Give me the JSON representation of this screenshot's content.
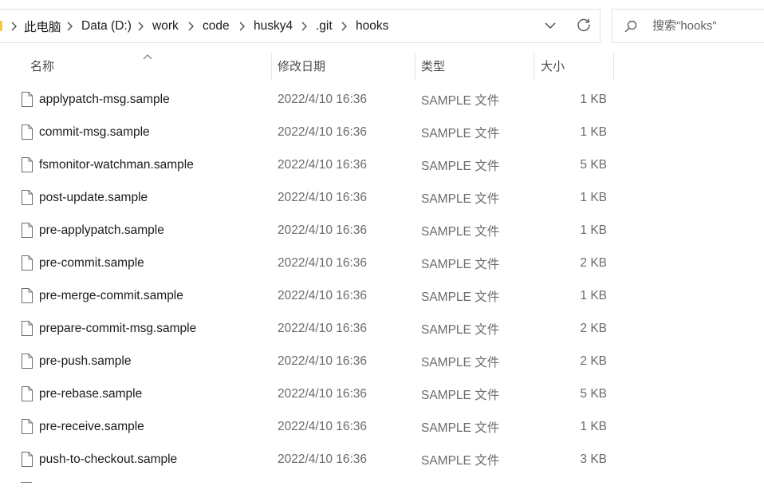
{
  "breadcrumb": {
    "items": [
      "此电脑",
      "Data (D:)",
      "work",
      "code",
      "husky4",
      ".git",
      "hooks"
    ]
  },
  "search": {
    "placeholder": "搜索\"hooks\""
  },
  "icons": {
    "separator": "chevron-right-icon",
    "dropdown": "chevron-down-icon",
    "refresh": "refresh-icon",
    "search": "search-icon",
    "file": "file-icon"
  },
  "columns": {
    "name": "名称",
    "date": "修改日期",
    "type": "类型",
    "size": "大小"
  },
  "files": [
    {
      "name": "applypatch-msg.sample",
      "date": "2022/4/10 16:36",
      "type": "SAMPLE 文件",
      "size": "1 KB"
    },
    {
      "name": "commit-msg.sample",
      "date": "2022/4/10 16:36",
      "type": "SAMPLE 文件",
      "size": "1 KB"
    },
    {
      "name": "fsmonitor-watchman.sample",
      "date": "2022/4/10 16:36",
      "type": "SAMPLE 文件",
      "size": "5 KB"
    },
    {
      "name": "post-update.sample",
      "date": "2022/4/10 16:36",
      "type": "SAMPLE 文件",
      "size": "1 KB"
    },
    {
      "name": "pre-applypatch.sample",
      "date": "2022/4/10 16:36",
      "type": "SAMPLE 文件",
      "size": "1 KB"
    },
    {
      "name": "pre-commit.sample",
      "date": "2022/4/10 16:36",
      "type": "SAMPLE 文件",
      "size": "2 KB"
    },
    {
      "name": "pre-merge-commit.sample",
      "date": "2022/4/10 16:36",
      "type": "SAMPLE 文件",
      "size": "1 KB"
    },
    {
      "name": "prepare-commit-msg.sample",
      "date": "2022/4/10 16:36",
      "type": "SAMPLE 文件",
      "size": "2 KB"
    },
    {
      "name": "pre-push.sample",
      "date": "2022/4/10 16:36",
      "type": "SAMPLE 文件",
      "size": "2 KB"
    },
    {
      "name": "pre-rebase.sample",
      "date": "2022/4/10 16:36",
      "type": "SAMPLE 文件",
      "size": "5 KB"
    },
    {
      "name": "pre-receive.sample",
      "date": "2022/4/10 16:36",
      "type": "SAMPLE 文件",
      "size": "1 KB"
    },
    {
      "name": "push-to-checkout.sample",
      "date": "2022/4/10 16:36",
      "type": "SAMPLE 文件",
      "size": "3 KB"
    }
  ]
}
